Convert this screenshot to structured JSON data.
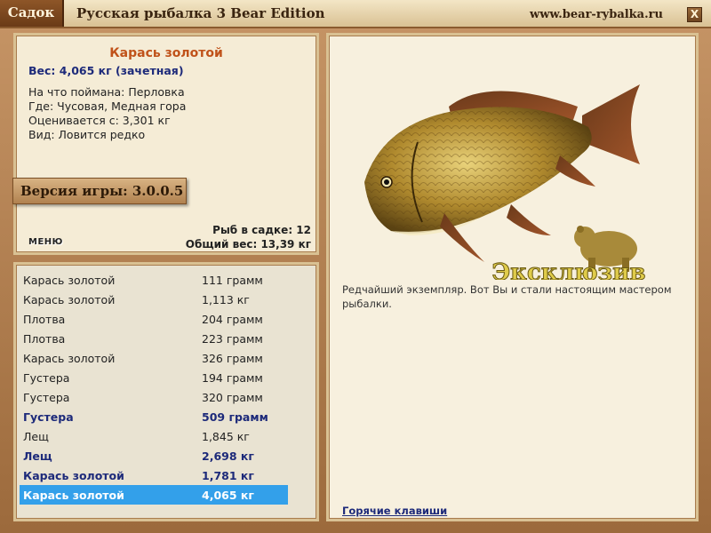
{
  "titlebar": {
    "tab_label": "Садок",
    "app_title": "Русская рыбалка 3 Bear Edition",
    "site_url": "www.bear-rybalka.ru",
    "close_label": "X"
  },
  "info": {
    "fish_name": "Карась золотой",
    "weight": "Вес: 4,065 кг (зачетная)",
    "bait": "На что поймана: Перловка",
    "location": "Где: Чусовая, Медная гора",
    "valued_from": "Оценивается с: 3,301 кг",
    "kind": "Вид: Ловится редко",
    "version": "Версия игры: 3.0.0.5",
    "menu_label": "МЕНЮ",
    "fish_in_keepnet": "Рыб в садке: 12",
    "total_weight": "Общий вес: 13,39 кг"
  },
  "catch_list": [
    {
      "name": "Карась золотой",
      "weight": "111 грамм",
      "style": "normal"
    },
    {
      "name": "Карась золотой",
      "weight": "1,113 кг",
      "style": "normal"
    },
    {
      "name": "Плотва",
      "weight": "204 грамм",
      "style": "normal"
    },
    {
      "name": "Плотва",
      "weight": "223 грамм",
      "style": "normal"
    },
    {
      "name": "Карась золотой",
      "weight": "326 грамм",
      "style": "normal"
    },
    {
      "name": "Густера",
      "weight": "194 грамм",
      "style": "normal"
    },
    {
      "name": "Густера",
      "weight": "320 грамм",
      "style": "normal"
    },
    {
      "name": "Густера",
      "weight": "509 грамм",
      "style": "bold"
    },
    {
      "name": "Лещ",
      "weight": "1,845 кг",
      "style": "normal"
    },
    {
      "name": "Лещ",
      "weight": "2,698 кг",
      "style": "bold"
    },
    {
      "name": "Карась золотой",
      "weight": "1,781 кг",
      "style": "bold"
    },
    {
      "name": "Карась золотой",
      "weight": "4,065 кг",
      "style": "selected"
    }
  ],
  "detail": {
    "badge_text": "Эксклюзив",
    "description": "Редчайший экземпляр. Вот Вы и стали настоящим мастером рыбалки.",
    "hotkeys_label": "Горячие клавиши"
  },
  "colors": {
    "accent_title": "#c0521a",
    "link_blue": "#1d2a7a",
    "selection": "#33a0ea"
  }
}
